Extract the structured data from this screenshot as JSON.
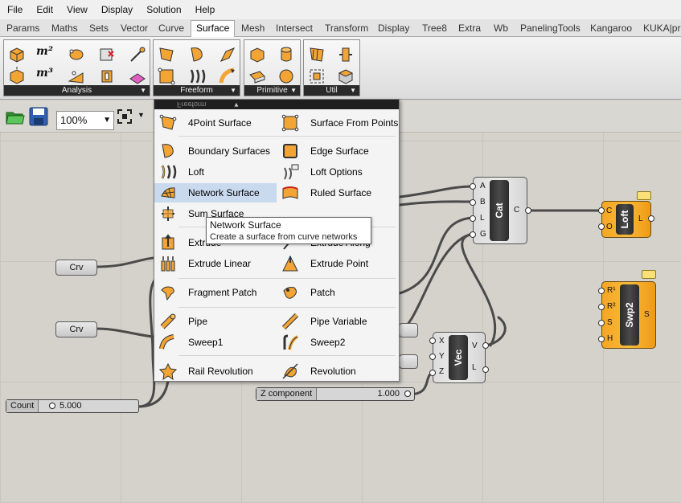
{
  "menubar": {
    "items": [
      "File",
      "Edit",
      "View",
      "Display",
      "Solution",
      "Help"
    ]
  },
  "tabs": {
    "items": [
      "Params",
      "Maths",
      "Sets",
      "Vector",
      "Curve",
      "Surface",
      "Mesh",
      "Intersect",
      "Transform",
      "Display",
      "Tree8",
      "Extra",
      "Wb",
      "PanelingTools",
      "Kangaroo",
      "KUKA|prc"
    ],
    "active": "Surface"
  },
  "ribbon": {
    "panels": [
      {
        "label": "Analysis",
        "m2": "m²",
        "m3": "m³"
      },
      {
        "label": "Freeform"
      },
      {
        "label": "Primitive"
      },
      {
        "label": "Util"
      }
    ]
  },
  "toolbar": {
    "zoom": "100%"
  },
  "dropdown": {
    "header": "Freeform",
    "left_items": [
      "4Point Surface",
      "Boundary Surfaces",
      "Loft",
      "Network Surface",
      "Sum Surface",
      "Extrude",
      "Extrude Linear",
      "Fragment Patch",
      "Pipe",
      "Sweep1",
      "Rail Revolution"
    ],
    "right_items": [
      "Surface From Points",
      "Edge Surface",
      "Loft Options",
      "Ruled Surface",
      "Extrude Along",
      "Extrude Point",
      "Patch",
      "Pipe Variable",
      "Sweep2",
      "Revolution"
    ],
    "highlighted": "Network Surface"
  },
  "tooltip": {
    "title": "Network Surface",
    "description": "Create a surface from curve networks"
  },
  "canvas": {
    "crv1_label": "Crv",
    "crv2_label": "Crv",
    "count_slider": {
      "name": "Count",
      "value": "5.000"
    },
    "z_slider": {
      "name": "Z component",
      "value": "1.000"
    },
    "cat": {
      "name": "Cat",
      "inputs": [
        "A",
        "B",
        "L",
        "G"
      ],
      "output": "C"
    },
    "loft": {
      "name": "Loft",
      "inputs": [
        "C",
        "O"
      ],
      "output": "L"
    },
    "swp2": {
      "name": "Swp2",
      "inputs": [
        "R¹",
        "R²",
        "S",
        "H"
      ],
      "output": "S"
    },
    "vec": {
      "name": "Vec",
      "inputs": [
        "X",
        "Y",
        "Z"
      ],
      "outputs": [
        "V",
        "L"
      ]
    }
  },
  "colors": {
    "component_orange": "#f5a623",
    "menu_highlight": "#c9d9ee",
    "ribbon_label_bg": "#2a2a2a"
  }
}
